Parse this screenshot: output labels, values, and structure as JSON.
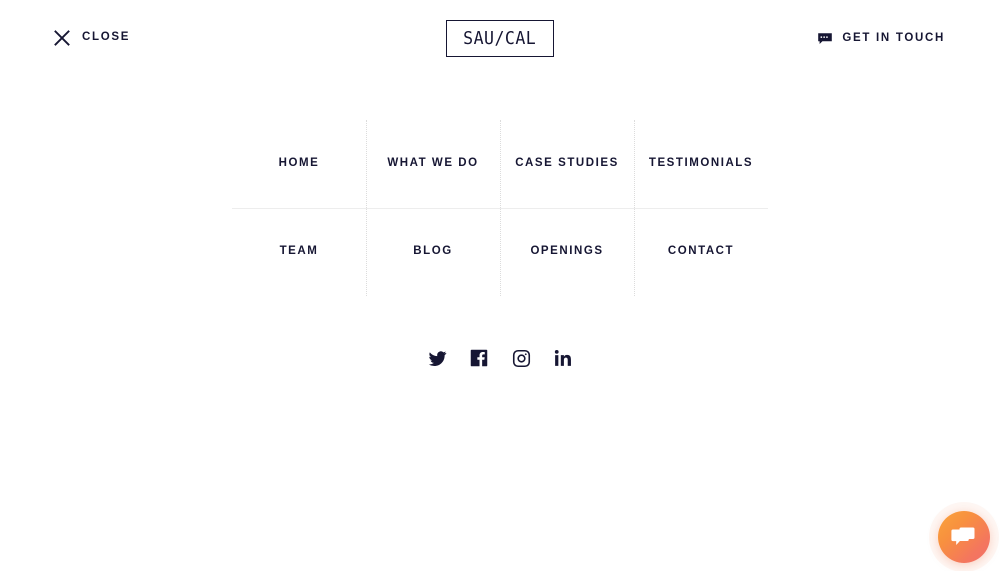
{
  "header": {
    "close": {
      "label": "CLOSE",
      "icon": "close-x-icon"
    },
    "logo": {
      "text": "SAU/CAL"
    },
    "get_in_touch": {
      "label": "GET IN TOUCH",
      "icon": "chat-bubble-icon"
    }
  },
  "nav": {
    "rows": [
      [
        {
          "label": "HOME"
        },
        {
          "label": "WHAT WE DO"
        },
        {
          "label": "CASE STUDIES"
        },
        {
          "label": "TESTIMONIALS"
        }
      ],
      [
        {
          "label": "TEAM"
        },
        {
          "label": "BLOG"
        },
        {
          "label": "OPENINGS"
        },
        {
          "label": "CONTACT"
        }
      ]
    ]
  },
  "socials": [
    {
      "name": "twitter",
      "title": "Twitter"
    },
    {
      "name": "facebook",
      "title": "Facebook"
    },
    {
      "name": "instagram",
      "title": "Instagram"
    },
    {
      "name": "linkedin",
      "title": "LinkedIn"
    }
  ],
  "chat_widget": {
    "icon": "chat-bubbles-icon",
    "title": "Open chat"
  },
  "colors": {
    "text": "#161633",
    "divider_solid": "#ededed",
    "divider_dotted": "#dcdcdc",
    "background": "#ffffff",
    "chat_gradient_start": "#faa43c",
    "chat_gradient_end": "#f1706a"
  }
}
